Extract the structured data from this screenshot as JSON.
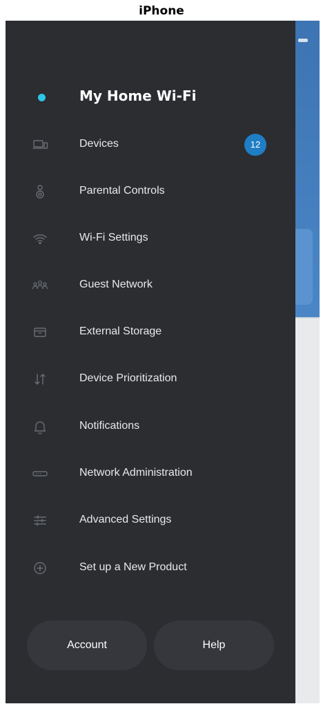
{
  "device_label": "iPhone",
  "drawer": {
    "title": "My Home Wi-Fi",
    "items": [
      {
        "label": "Devices",
        "icon": "devices-icon",
        "badge": "12"
      },
      {
        "label": "Parental Controls",
        "icon": "parental-controls-icon"
      },
      {
        "label": "Wi-Fi Settings",
        "icon": "wifi-icon"
      },
      {
        "label": "Guest Network",
        "icon": "guest-network-icon"
      },
      {
        "label": "External Storage",
        "icon": "storage-icon"
      },
      {
        "label": "Device Prioritization",
        "icon": "prioritization-icon"
      },
      {
        "label": "Notifications",
        "icon": "bell-icon"
      },
      {
        "label": "Network Administration",
        "icon": "router-icon"
      },
      {
        "label": "Advanced Settings",
        "icon": "sliders-icon"
      },
      {
        "label": "Set up a New Product",
        "icon": "plus-circle-icon"
      }
    ],
    "account_label": "Account",
    "help_label": "Help"
  },
  "colors": {
    "drawer_bg": "#2b2d31",
    "accent": "#2cc7ea",
    "badge_bg": "#1f7ec4",
    "pill_bg": "#35373c"
  }
}
